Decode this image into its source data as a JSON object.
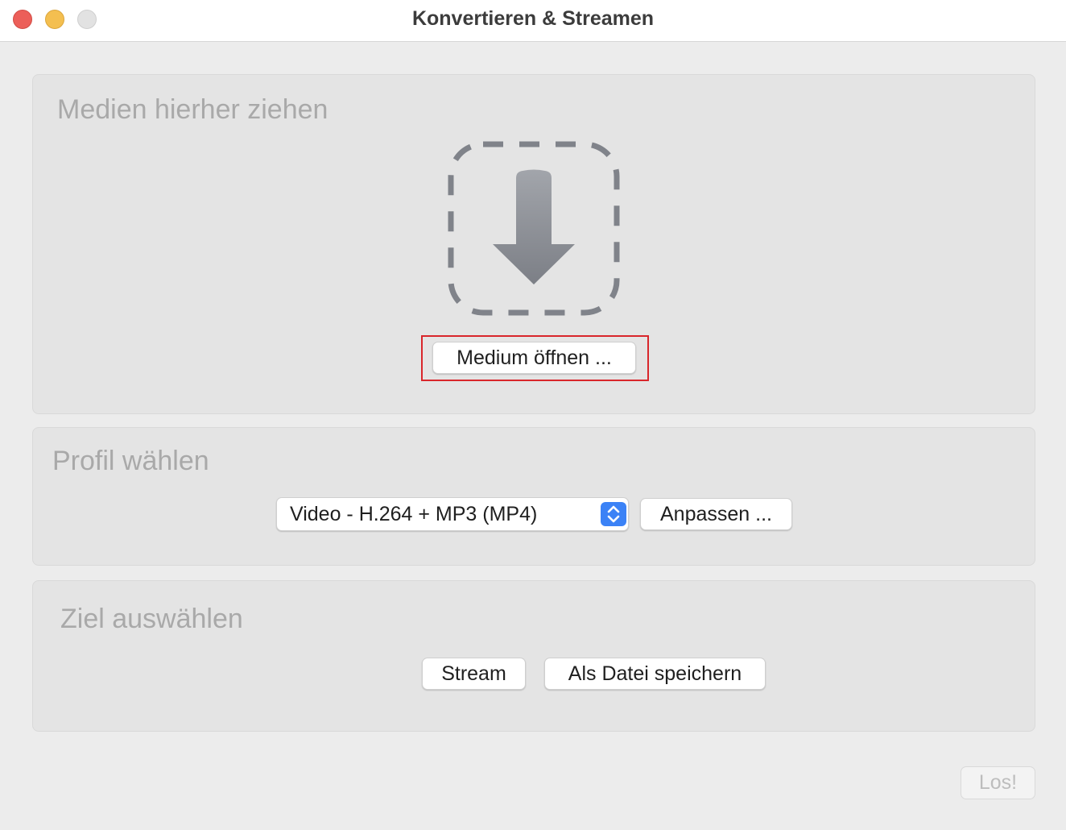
{
  "window": {
    "title": "Konvertieren & Streamen"
  },
  "media_panel": {
    "title": "Medien hierher ziehen",
    "icon": "drop-arrow-icon",
    "open_button_label": "Medium öffnen ..."
  },
  "profile_panel": {
    "title": "Profil wählen",
    "selected_profile": "Video - H.264 + MP3 (MP4)",
    "customize_button_label": "Anpassen ..."
  },
  "destination_panel": {
    "title": "Ziel auswählen",
    "stream_button_label": "Stream",
    "save_file_button_label": "Als Datei speichern"
  },
  "footer": {
    "go_button_label": "Los!"
  },
  "colors": {
    "close": "#ec5f59",
    "minimize": "#f4bf50",
    "accent": "#3b82f6",
    "highlight": "#d9262b"
  }
}
